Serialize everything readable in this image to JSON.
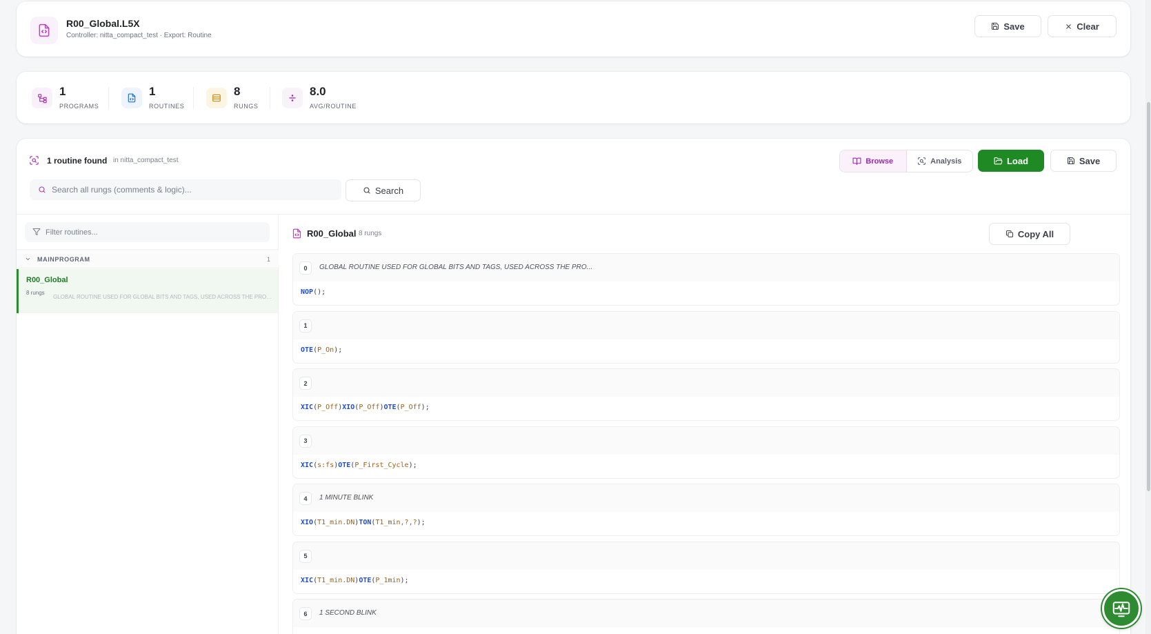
{
  "header": {
    "file_name": "R00_Global.L5X",
    "subtitle": "Controller: nitta_compact_test · Export: Routine",
    "save_label": "Save",
    "clear_label": "Clear"
  },
  "stats": [
    {
      "value": "1",
      "label": "PROGRAMS",
      "icon": "program-tree-icon",
      "color": "#9c27b0"
    },
    {
      "value": "1",
      "label": "ROUTINES",
      "icon": "file-code-icon",
      "color": "#1e6fd9"
    },
    {
      "value": "8",
      "label": "RUNGS",
      "icon": "rows-icon",
      "color": "#c98a10"
    },
    {
      "value": "8.0",
      "label": "AVG/ROUTINE",
      "icon": "divide-icon",
      "color": "#9c27b0"
    }
  ],
  "browser": {
    "found_text": "1 routine found",
    "found_sub": "in nitta_compact_test",
    "tabs": {
      "browse": "Browse",
      "analysis": "Analysis"
    },
    "load_label": "Load",
    "save_label": "Save",
    "search_placeholder": "Search all rungs (comments & logic)...",
    "search_label": "Search",
    "filter_placeholder": "Filter routines...",
    "program_group": {
      "name": "MAINPROGRAM",
      "count": "1"
    },
    "routine_item": {
      "name": "R00_Global",
      "rung_count": "8 rungs",
      "description": "GLOBAL ROUTINE USED FOR GLOBAL BITS AND TAGS, USED ACROSS THE PROGRAM"
    },
    "main_title": "R00_Global",
    "main_sub": "8 rungs",
    "copy_all_label": "Copy All"
  },
  "rungs": [
    {
      "number": "0",
      "comment": "GLOBAL ROUTINE USED FOR GLOBAL BITS AND TAGS, USED ACROSS THE PRO...",
      "code": [
        {
          "t": "NOP",
          "k": "kw"
        },
        {
          "t": "();",
          "k": "p"
        }
      ]
    },
    {
      "number": "1",
      "comment": "",
      "code": [
        {
          "t": "OTE",
          "k": "kw"
        },
        {
          "t": "(",
          "k": "p"
        },
        {
          "t": "P_On",
          "k": "tg"
        },
        {
          "t": ");",
          "k": "p"
        }
      ]
    },
    {
      "number": "2",
      "comment": "",
      "code": [
        {
          "t": "XIC",
          "k": "kw"
        },
        {
          "t": "(",
          "k": "p"
        },
        {
          "t": "P_Off",
          "k": "tg"
        },
        {
          "t": ")",
          "k": "p"
        },
        {
          "t": "XIO",
          "k": "kw"
        },
        {
          "t": "(",
          "k": "p"
        },
        {
          "t": "P_Off",
          "k": "tg"
        },
        {
          "t": ")",
          "k": "p"
        },
        {
          "t": "OTE",
          "k": "kw"
        },
        {
          "t": "(",
          "k": "p"
        },
        {
          "t": "P_Off",
          "k": "tg"
        },
        {
          "t": ");",
          "k": "p"
        }
      ]
    },
    {
      "number": "3",
      "comment": "",
      "code": [
        {
          "t": "XIC",
          "k": "kw"
        },
        {
          "t": "(",
          "k": "p"
        },
        {
          "t": "s:fs",
          "k": "tg"
        },
        {
          "t": ")",
          "k": "p"
        },
        {
          "t": "OTE",
          "k": "kw"
        },
        {
          "t": "(",
          "k": "p"
        },
        {
          "t": "P_First_Cycle",
          "k": "tg"
        },
        {
          "t": ");",
          "k": "p"
        }
      ]
    },
    {
      "number": "4",
      "comment": "1 MINUTE BLINK",
      "code": [
        {
          "t": "XIO",
          "k": "kw"
        },
        {
          "t": "(",
          "k": "p"
        },
        {
          "t": "T1_min.DN",
          "k": "tg"
        },
        {
          "t": ")",
          "k": "p"
        },
        {
          "t": "TON",
          "k": "kw"
        },
        {
          "t": "(",
          "k": "p"
        },
        {
          "t": "T1_min,?,?",
          "k": "tg"
        },
        {
          "t": ");",
          "k": "p"
        }
      ]
    },
    {
      "number": "5",
      "comment": "",
      "code": [
        {
          "t": "XIC",
          "k": "kw"
        },
        {
          "t": "(",
          "k": "p"
        },
        {
          "t": "T1_min.DN",
          "k": "tg"
        },
        {
          "t": ")",
          "k": "p"
        },
        {
          "t": "OTE",
          "k": "kw"
        },
        {
          "t": "(",
          "k": "p"
        },
        {
          "t": "P_1min",
          "k": "tg"
        },
        {
          "t": ");",
          "k": "p"
        }
      ]
    },
    {
      "number": "6",
      "comment": "1 SECOND BLINK",
      "code": []
    }
  ],
  "colors": {
    "accent": "#9c27b0",
    "primary_green": "#1f8a24",
    "keyword": "#1d4ed8",
    "tag": "#a06010"
  }
}
